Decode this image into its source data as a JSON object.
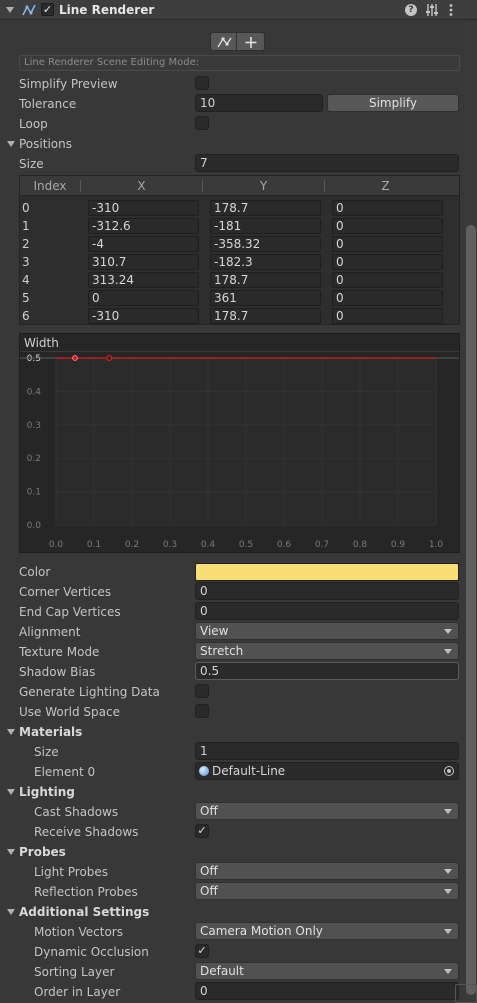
{
  "header": {
    "title": "Line Renderer",
    "icons": [
      "collapse-triangle-icon",
      "line-renderer-icon",
      "enabled-checkbox",
      "help-icon",
      "preset-icon",
      "context-menu-icon"
    ]
  },
  "editing": {
    "mode_label": "Line Renderer Scene Editing Mode:",
    "tools": [
      "edit-points-icon",
      "create-points-icon"
    ]
  },
  "simplify_preview": {
    "label": "Simplify Preview",
    "checked": false
  },
  "tolerance": {
    "label": "Tolerance",
    "value": "10",
    "button": "Simplify"
  },
  "loop": {
    "label": "Loop",
    "checked": false
  },
  "positions": {
    "label": "Positions",
    "size_label": "Size",
    "size": "7",
    "columns": [
      "Index",
      "X",
      "Y",
      "Z"
    ],
    "rows": [
      [
        "0",
        "-310",
        "178.7",
        "0"
      ],
      [
        "1",
        "-312.6",
        "-181",
        "0"
      ],
      [
        "2",
        "-4",
        "-358.32",
        "0"
      ],
      [
        "3",
        "310.7",
        "-182.3",
        "0"
      ],
      [
        "4",
        "313.24",
        "178.7",
        "0"
      ],
      [
        "5",
        "0",
        "361",
        "0"
      ],
      [
        "6",
        "-310",
        "178.7",
        "0"
      ]
    ]
  },
  "width_curve": {
    "label": "Width",
    "y_ticks": [
      "0.5",
      "0.4",
      "0.3",
      "0.2",
      "0.1",
      "0.0"
    ],
    "x_ticks": [
      "0.0",
      "0.1",
      "0.2",
      "0.3",
      "0.4",
      "0.5",
      "0.6",
      "0.7",
      "0.8",
      "0.9",
      "1.0"
    ],
    "value": 0.5,
    "line_color": "#d11f1f"
  },
  "color": {
    "label": "Color",
    "value": "#f9dd75"
  },
  "corner_vertices": {
    "label": "Corner Vertices",
    "value": "0"
  },
  "end_cap_vertices": {
    "label": "End Cap Vertices",
    "value": "0"
  },
  "alignment": {
    "label": "Alignment",
    "value": "View"
  },
  "texture_mode": {
    "label": "Texture Mode",
    "value": "Stretch"
  },
  "shadow_bias": {
    "label": "Shadow Bias",
    "value": "0.5"
  },
  "generate_lighting_data": {
    "label": "Generate Lighting Data",
    "checked": false
  },
  "use_world_space": {
    "label": "Use World Space",
    "checked": false
  },
  "materials": {
    "label": "Materials",
    "size_label": "Size",
    "size": "1",
    "element_label": "Element 0",
    "element_value": "Default-Line"
  },
  "lighting": {
    "label": "Lighting",
    "cast_shadows_label": "Cast Shadows",
    "cast_shadows": "Off",
    "receive_shadows_label": "Receive Shadows",
    "receive_shadows": true
  },
  "probes": {
    "label": "Probes",
    "light_probes_label": "Light Probes",
    "light_probes": "Off",
    "reflection_probes_label": "Reflection Probes",
    "reflection_probes": "Off"
  },
  "additional": {
    "label": "Additional Settings",
    "motion_vectors_label": "Motion Vectors",
    "motion_vectors": "Camera Motion Only",
    "dynamic_occlusion_label": "Dynamic Occlusion",
    "dynamic_occlusion": true,
    "sorting_layer_label": "Sorting Layer",
    "sorting_layer": "Default",
    "order_in_layer_label": "Order in Layer",
    "order_in_layer": "0"
  },
  "checkmark": "✓"
}
